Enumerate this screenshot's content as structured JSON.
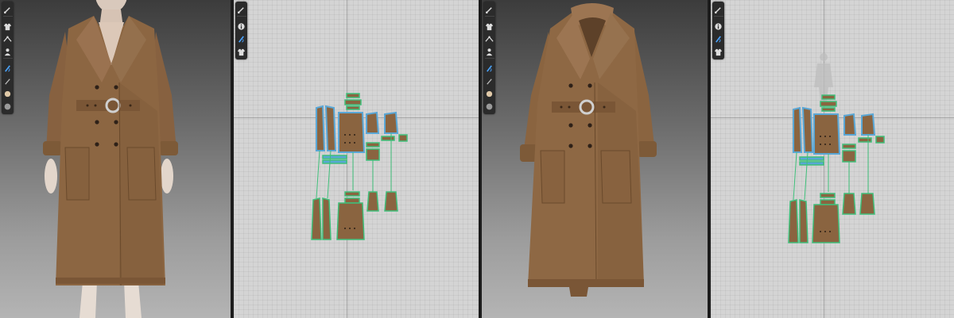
{
  "colors": {
    "garment": "#8a6440",
    "garment_light": "#a47c55",
    "garment_dark": "#6a4a2c",
    "pattern_outline": "#5aa7d6",
    "seam_green": "#3fbf7a",
    "toolbar_bg": "#2b2b2b",
    "icon_accent": "#4aa3ff"
  },
  "views": [
    {
      "id": "3d-view-a",
      "kind": "3D Garment"
    },
    {
      "id": "2d-view-a",
      "kind": "2D Pattern"
    },
    {
      "id": "3d-view-b",
      "kind": "3D Garment"
    },
    {
      "id": "2d-view-b",
      "kind": "2D Pattern"
    }
  ],
  "toolbar_3d": {
    "icons": [
      "brush-icon",
      "garment-icon",
      "fold-icon",
      "avatar-icon",
      "needle-icon",
      "pen-icon",
      "face-icon",
      "sphere-icon"
    ]
  },
  "toolbar_2d": {
    "icons": [
      "brush-icon",
      "info-icon",
      "needle-icon",
      "garment-icon"
    ]
  }
}
